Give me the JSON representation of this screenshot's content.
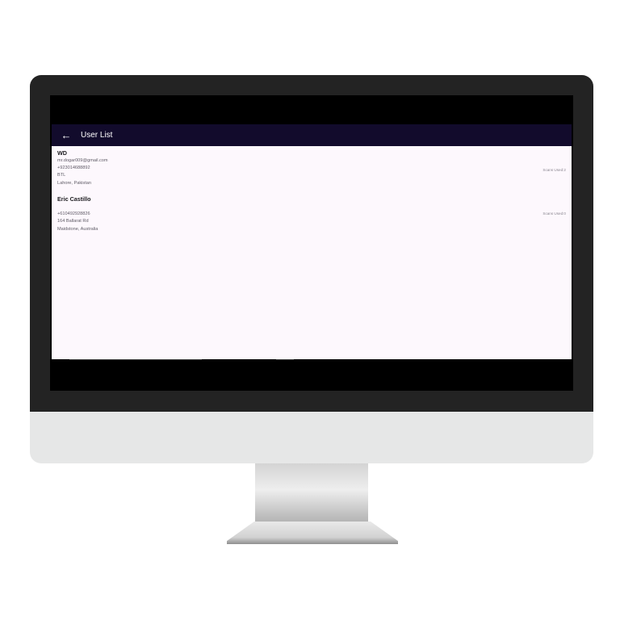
{
  "appbar": {
    "back_icon": "arrow-left-icon",
    "title": "User List"
  },
  "users": [
    {
      "name": "WD",
      "email": "mr.dogar009@gmail.com",
      "phone": "+923014688892",
      "address": "BTL",
      "city": "Lahore, Pakistan",
      "scans": "Scans Used:2"
    },
    {
      "name": "Eric Castillo",
      "email": "",
      "phone": "+610492928826",
      "address": "164 Ballarat Rd",
      "city": "Maidstone, Australia",
      "scans": "Scans Used:0"
    }
  ],
  "colors": {
    "appbar": "#120b2c",
    "background": "#fdf8fd",
    "bezel": "#232323",
    "chin": "#e6e7e7"
  }
}
